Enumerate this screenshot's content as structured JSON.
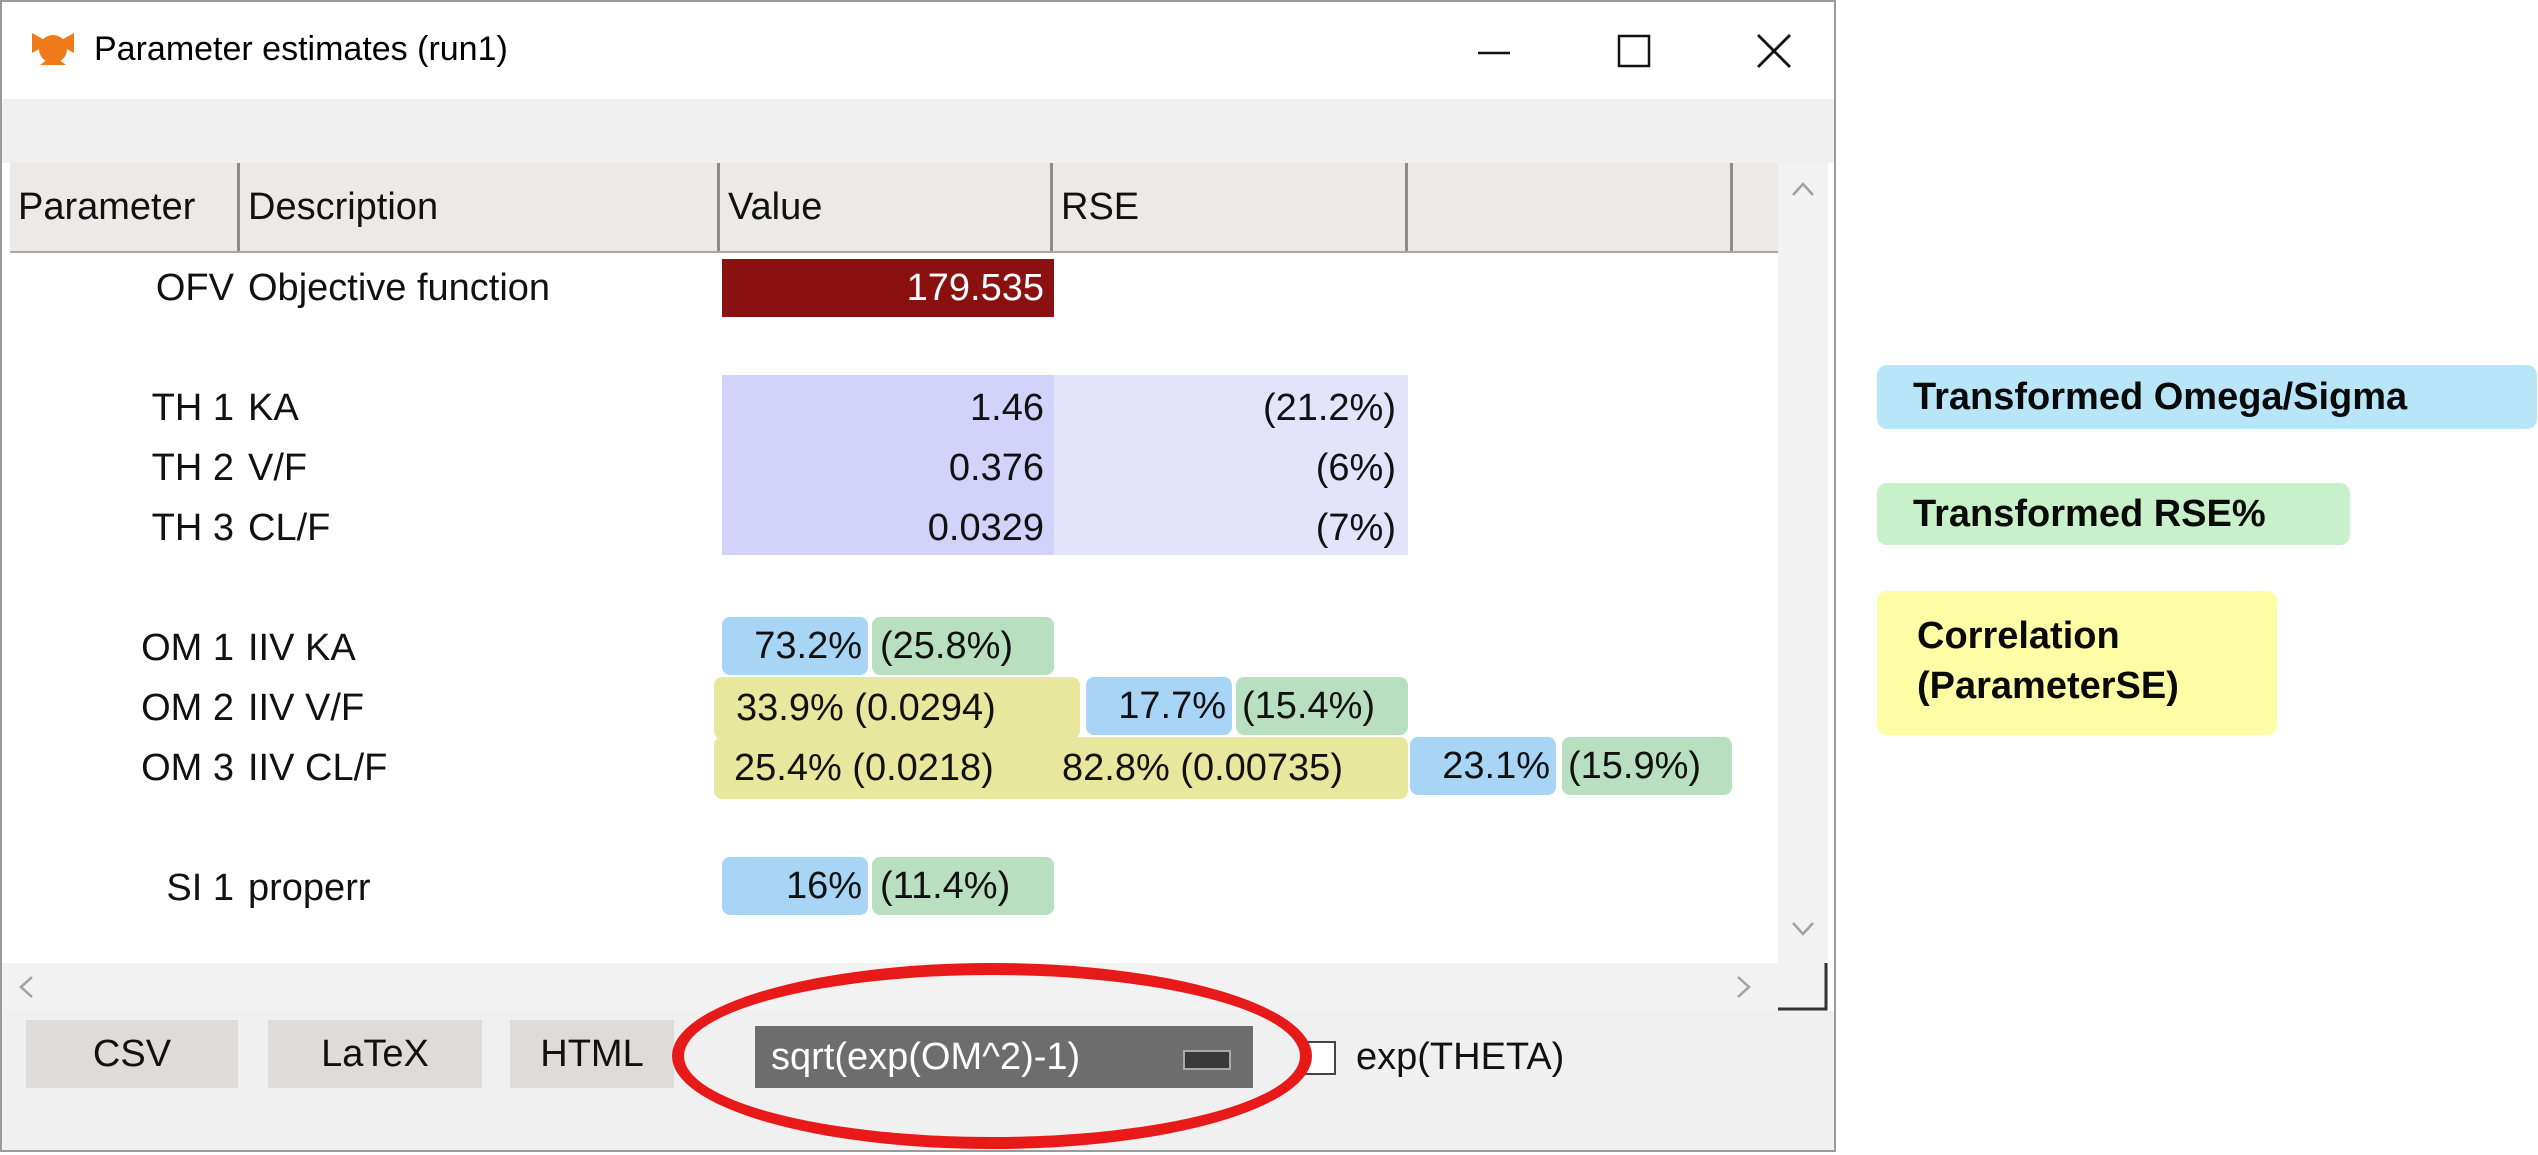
{
  "window": {
    "title": "Parameter estimates (run1)"
  },
  "table": {
    "headers": [
      "Parameter",
      "Description",
      "Value",
      "RSE",
      ""
    ],
    "ofv": {
      "param": "OFV",
      "desc": "Objective function",
      "value": "179.535"
    },
    "thetas": [
      {
        "param": "TH 1",
        "desc": "KA",
        "value": "1.46",
        "rse": "(21.2%)"
      },
      {
        "param": "TH 2",
        "desc": "V/F",
        "value": "0.376",
        "rse": "(6%)"
      },
      {
        "param": "TH 3",
        "desc": "CL/F",
        "value": "0.0329",
        "rse": "(7%)"
      }
    ],
    "omegas": [
      {
        "param": "OM 1",
        "desc": "IIV KA",
        "cells": [
          "73.2%",
          "(25.8%)"
        ]
      },
      {
        "param": "OM 2",
        "desc": "IIV V/F",
        "cells": [
          "33.9% (0.0294)",
          "17.7%",
          "(15.4%)"
        ]
      },
      {
        "param": "OM 3",
        "desc": "IIV CL/F",
        "cells": [
          "25.4% (0.0218)",
          "82.8% (0.00735)",
          "23.1%",
          "(15.9%)"
        ]
      }
    ],
    "sigmas": [
      {
        "param": "SI 1",
        "desc": "properr",
        "cells": [
          "16%",
          "(11.4%)"
        ]
      }
    ]
  },
  "bottombar": {
    "csv": "CSV",
    "latex": "LaTeX",
    "html": "HTML",
    "transform_select": "sqrt(exp(OM^2)-1)",
    "exp_theta_label": "exp(THETA)",
    "exp_theta_checked": false
  },
  "legend": {
    "omega_sigma": "Transformed Omega/Sigma",
    "rse": "Transformed RSE%",
    "correlation_line1": "Correlation",
    "correlation_line2": "(ParameterSE)"
  },
  "colors": {
    "ofv_bg": "#8b1010",
    "theta_value_bg": "#d2d2fb",
    "theta_rse_bg": "#e3e3fb",
    "omega_blue": "#a8d4f5",
    "rse_green": "#b9dfc1",
    "corr_yellow": "#e8e79e",
    "highlight_oval": "#e81919"
  }
}
